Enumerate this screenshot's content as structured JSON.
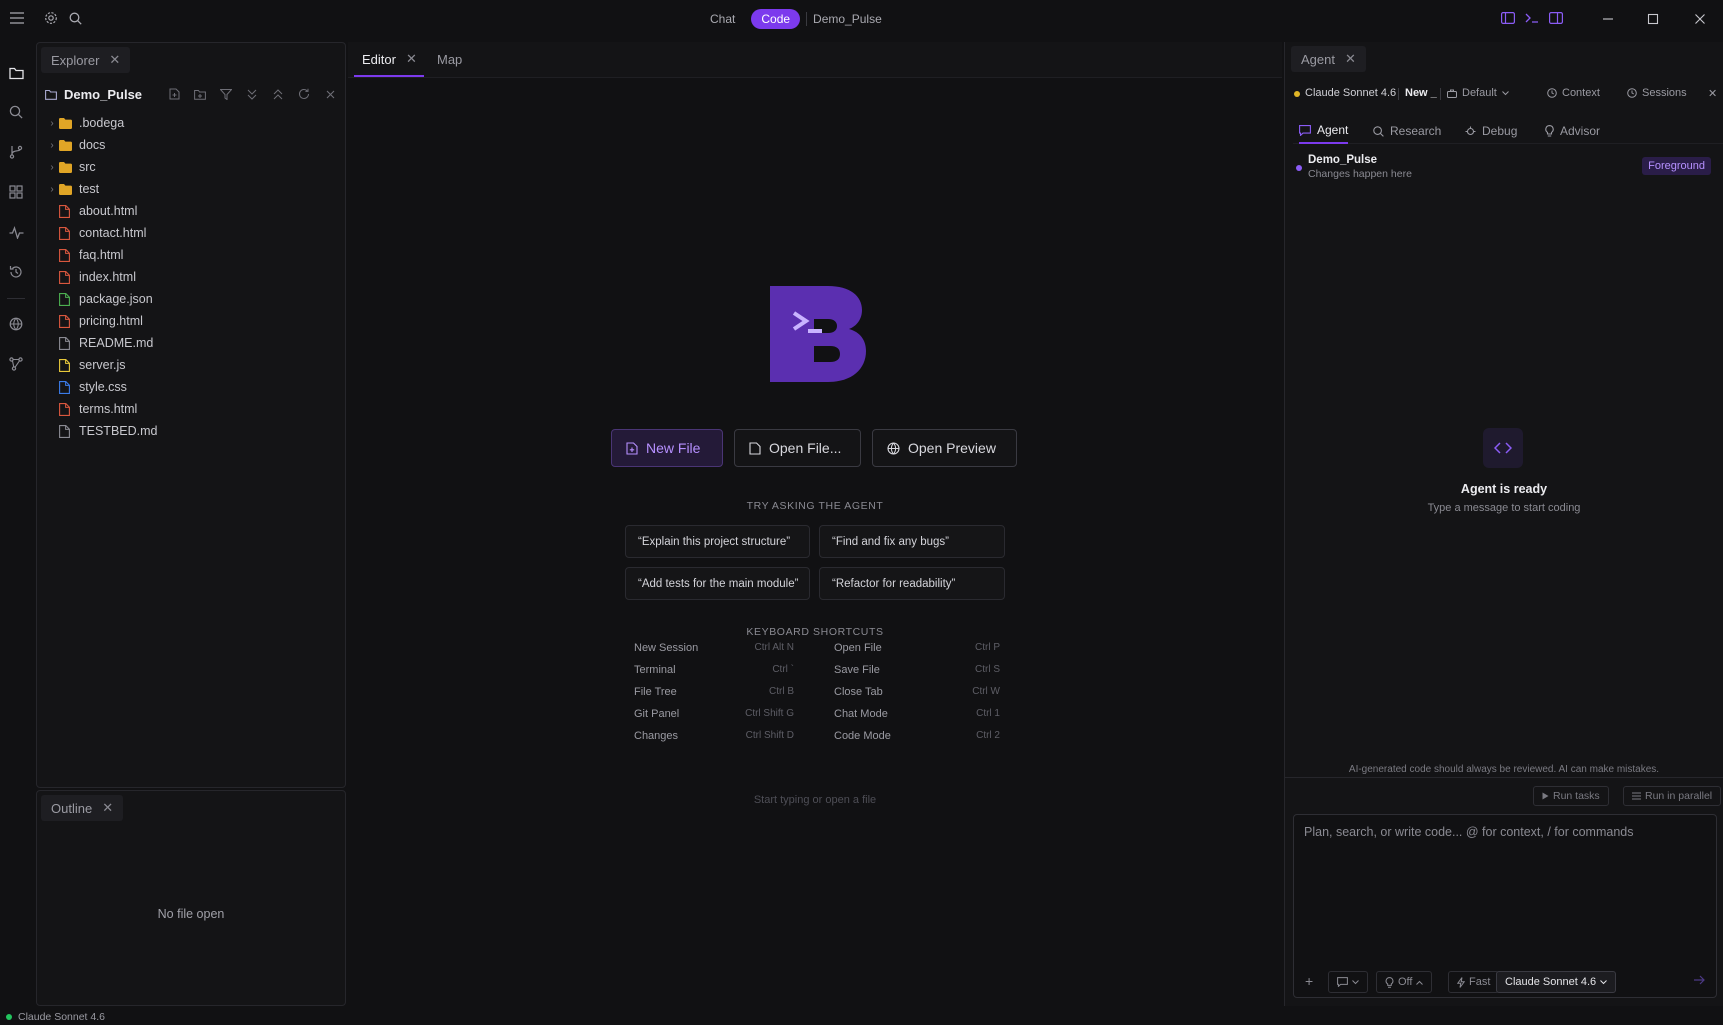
{
  "titlebar": {
    "mode_chat": "Chat",
    "mode_code": "Code",
    "project": "Demo_Pulse"
  },
  "explorer": {
    "tab_label": "Explorer",
    "project_name": "Demo_Pulse",
    "folders": [
      ".bodega",
      "docs",
      "src",
      "test"
    ],
    "files": [
      {
        "name": "about.html",
        "type": "html"
      },
      {
        "name": "contact.html",
        "type": "html"
      },
      {
        "name": "faq.html",
        "type": "html"
      },
      {
        "name": "index.html",
        "type": "html"
      },
      {
        "name": "package.json",
        "type": "json"
      },
      {
        "name": "pricing.html",
        "type": "html"
      },
      {
        "name": "README.md",
        "type": "md"
      },
      {
        "name": "server.js",
        "type": "js"
      },
      {
        "name": "style.css",
        "type": "css"
      },
      {
        "name": "terms.html",
        "type": "html"
      },
      {
        "name": "TESTBED.md",
        "type": "md"
      }
    ]
  },
  "outline": {
    "tab_label": "Outline",
    "empty_text": "No file open"
  },
  "editor": {
    "tab_editor": "Editor",
    "tab_map": "Map",
    "new_file": "New File",
    "open_file": "Open File...",
    "open_preview": "Open Preview",
    "try_label": "TRY ASKING THE AGENT",
    "suggestions": [
      "“Explain this project structure”",
      "“Find and fix any bugs”",
      "“Add tests for the main module”",
      "“Refactor for readability”"
    ],
    "shortcuts_label": "KEYBOARD SHORTCUTS",
    "shortcuts_left": [
      {
        "name": "New Session",
        "key": "Ctrl Alt N"
      },
      {
        "name": "Terminal",
        "key": "Ctrl `"
      },
      {
        "name": "File Tree",
        "key": "Ctrl B"
      },
      {
        "name": "Git Panel",
        "key": "Ctrl Shift G"
      },
      {
        "name": "Changes",
        "key": "Ctrl Shift D"
      }
    ],
    "shortcuts_right": [
      {
        "name": "Open File",
        "key": "Ctrl P"
      },
      {
        "name": "Save File",
        "key": "Ctrl S"
      },
      {
        "name": "Close Tab",
        "key": "Ctrl W"
      },
      {
        "name": "Chat Mode",
        "key": "Ctrl 1"
      },
      {
        "name": "Code Mode",
        "key": "Ctrl 2"
      }
    ],
    "hint": "Start typing or open a file"
  },
  "agent": {
    "tab_label": "Agent",
    "model": "Claude Sonnet 4.6",
    "new_label": "New _",
    "default_label": "Default",
    "context_label": "Context",
    "sessions_label": "Sessions",
    "modes": [
      "Agent",
      "Research",
      "Debug",
      "Advisor"
    ],
    "session_name": "Demo_Pulse",
    "session_sub": "Changes happen here",
    "badge": "Foreground",
    "ready_title": "Agent is ready",
    "ready_sub": "Type a message to start coding",
    "disclaimer": "AI-generated code should always be reviewed. AI can make mistakes.",
    "run_tasks": "Run tasks",
    "run_parallel": "Run in parallel",
    "placeholder": "Plan, search, or write code... @ for context, / for commands",
    "think_label": "Off",
    "fast_label": "Fast",
    "model_select": "Claude Sonnet 4.6"
  },
  "statusbar": {
    "model": "Claude Sonnet 4.6"
  },
  "colors": {
    "accent": "#7c3aed",
    "folder": "#e0a526",
    "html_file": "#d9573e",
    "json_file": "#4caf50",
    "js_file": "#e8c93b",
    "css_file": "#3b7be8",
    "status_ok": "#22c55e"
  }
}
